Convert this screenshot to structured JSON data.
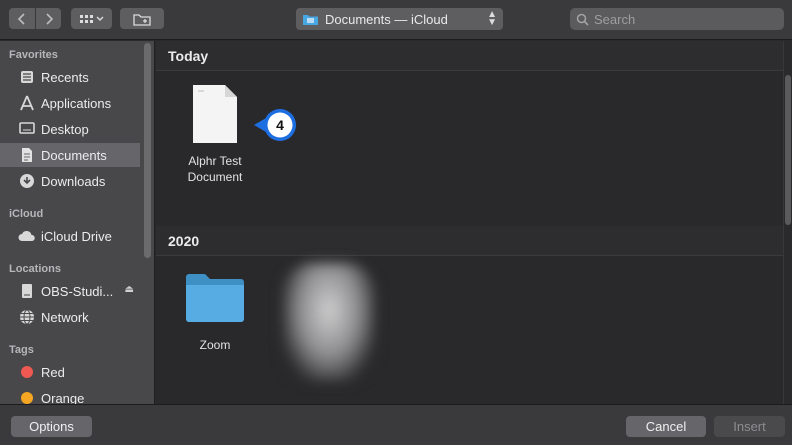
{
  "toolbar": {
    "back_icon": "chevron-left",
    "forward_icon": "chevron-right",
    "view_icon": "grid-view",
    "new_folder_icon": "new-folder",
    "location": "Documents — iCloud",
    "search_placeholder": "Search"
  },
  "sidebar": {
    "sections": {
      "favorites": "Favorites",
      "icloud": "iCloud",
      "locations": "Locations",
      "tags": "Tags"
    },
    "favorites": [
      {
        "label": "Recents",
        "icon": "clock-icon"
      },
      {
        "label": "Applications",
        "icon": "applications-icon"
      },
      {
        "label": "Desktop",
        "icon": "desktop-icon"
      },
      {
        "label": "Documents",
        "icon": "document-icon",
        "selected": true
      },
      {
        "label": "Downloads",
        "icon": "download-icon"
      }
    ],
    "icloud": [
      {
        "label": "iCloud Drive",
        "icon": "cloud-icon"
      }
    ],
    "locations": [
      {
        "label": "OBS-Studi...",
        "icon": "disk-icon"
      },
      {
        "label": "Network",
        "icon": "globe-icon"
      }
    ],
    "tags": [
      {
        "label": "Red",
        "color": "#ee5a51"
      },
      {
        "label": "Orange",
        "color": "#f5a623"
      }
    ]
  },
  "main": {
    "groups": [
      {
        "title": "Today",
        "files": [
          {
            "name": "Alphr Test Document",
            "name_line1": "Alphr Test",
            "name_line2": "Document",
            "type": "document"
          }
        ]
      },
      {
        "title": "2020",
        "files": [
          {
            "name": "Zoom",
            "type": "folder"
          }
        ]
      }
    ],
    "callout_number": "4",
    "accent_color": "#1d6ee0"
  },
  "bottom": {
    "options": "Options",
    "cancel": "Cancel",
    "insert": "Insert"
  }
}
